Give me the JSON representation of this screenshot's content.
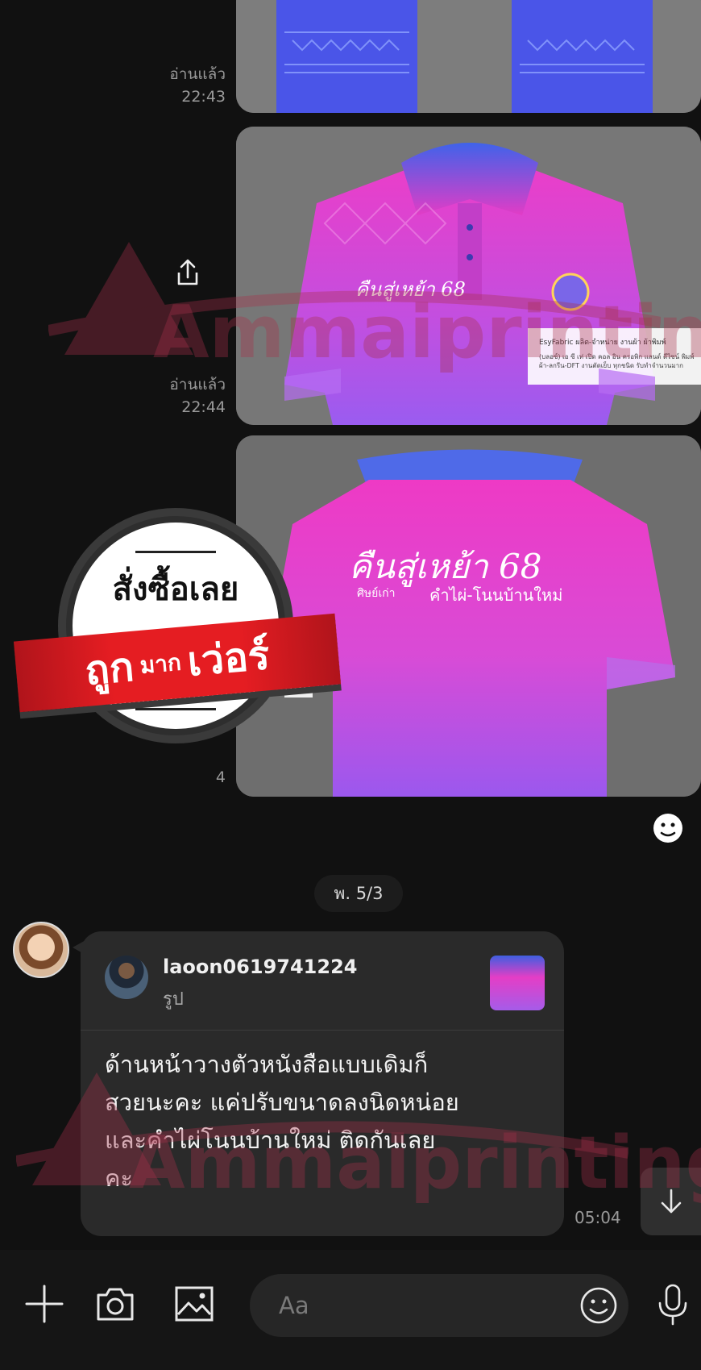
{
  "messages": [
    {
      "read_label": "อ่านแล้ว",
      "time": "22:43"
    },
    {
      "read_label": "อ่านแล้ว",
      "time": "22:44"
    },
    {
      "time_partial": "4"
    }
  ],
  "shirt_front": {
    "print_text": "คืนสู่เหย้า 68",
    "tag_brand": "EsyFabric ผลิต-จำหน่าย งานผ้า ผ้าพิมพ์",
    "tag_line": "(บลอซ์) เอ ซี เท่ เปิด คอล อิน ครอพิก แลนด์ ดีไซน์ พิมพ์ผ้า-ลกรีน-DFT งานตัดเย็บ ทุกชนิด รับทำจำนวนมาก"
  },
  "shirt_back": {
    "print_title": "คืนสู่เหย้า 68",
    "print_sub_left": "ศิษย์เก่า",
    "print_sub": "คำไผ่-โนนบ้านใหม่"
  },
  "promo": {
    "line_top": "สั่งซื้อเลย",
    "ribbon_big_1": "ถูก",
    "ribbon_small": "มาก",
    "ribbon_big_2": "เว่อร์"
  },
  "date_divider": "พ. 5/3",
  "incoming": {
    "reply": {
      "name": "laoon0619741224",
      "type": "รูป"
    },
    "text_lines": [
      "ด้านหน้าวางตัวหนังสือแบบเดิมก็",
      "สวยนะคะ แค่ปรับขนาดลงนิดหน่อย",
      "และคำไผ่โนนบ้านใหม่  ติดกันเลย",
      "คะ"
    ],
    "time": "05:04"
  },
  "watermark": "Ammaiprinting",
  "input": {
    "placeholder": "Aa"
  },
  "icons": [
    "share-icon",
    "sticker-icon",
    "arrow-down-icon",
    "plus-icon",
    "camera-icon",
    "image-icon",
    "emoji-icon",
    "mic-icon"
  ],
  "colors": {
    "background": "#111111",
    "bubble": "#2a2a2a",
    "promo_red": "#e51d22",
    "shirt_pink": "#e43ec6"
  }
}
